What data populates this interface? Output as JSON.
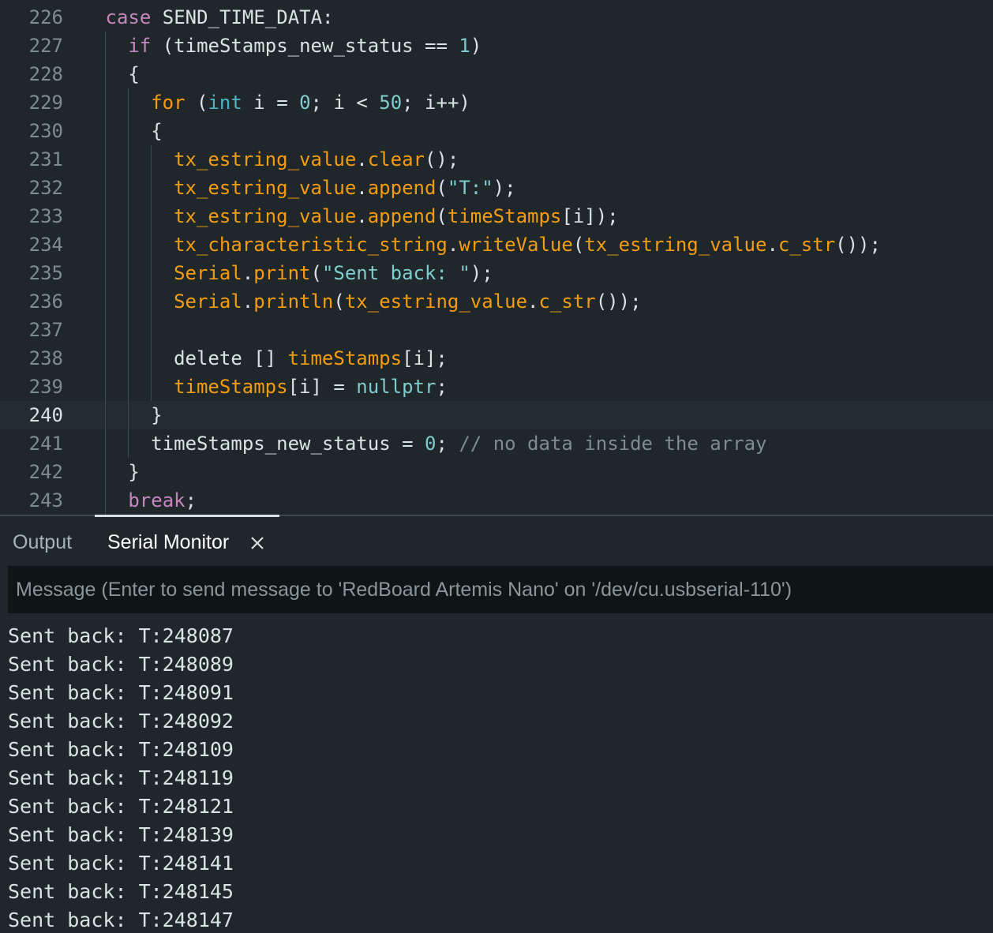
{
  "editor": {
    "lines": [
      {
        "num": "226",
        "indent": 8,
        "tokens": [
          [
            "kw",
            "case"
          ],
          [
            "id",
            " SEND_TIME_DATA:"
          ]
        ]
      },
      {
        "num": "227",
        "indent": 9,
        "tokens": [
          [
            "kw",
            "if"
          ],
          [
            "id",
            " (timeStamps_new_status == "
          ],
          [
            "num",
            "1"
          ],
          [
            "id",
            ")"
          ]
        ]
      },
      {
        "num": "228",
        "indent": 9,
        "tokens": [
          [
            "id",
            "{"
          ]
        ]
      },
      {
        "num": "229",
        "indent": 10,
        "tokens": [
          [
            "kw2",
            "for"
          ],
          [
            "id",
            " ("
          ],
          [
            "type",
            "int"
          ],
          [
            "id",
            " i = "
          ],
          [
            "num",
            "0"
          ],
          [
            "id",
            "; i < "
          ],
          [
            "num",
            "50"
          ],
          [
            "id",
            "; i++)"
          ]
        ]
      },
      {
        "num": "230",
        "indent": 10,
        "tokens": [
          [
            "id",
            "{"
          ]
        ]
      },
      {
        "num": "231",
        "indent": 11,
        "tokens": [
          [
            "fn",
            "tx_estring_value"
          ],
          [
            "id",
            "."
          ],
          [
            "fn",
            "clear"
          ],
          [
            "id",
            "();"
          ]
        ]
      },
      {
        "num": "232",
        "indent": 11,
        "tokens": [
          [
            "fn",
            "tx_estring_value"
          ],
          [
            "id",
            "."
          ],
          [
            "fn",
            "append"
          ],
          [
            "id",
            "("
          ],
          [
            "str",
            "\"T:\""
          ],
          [
            "id",
            ");"
          ]
        ]
      },
      {
        "num": "233",
        "indent": 11,
        "tokens": [
          [
            "fn",
            "tx_estring_value"
          ],
          [
            "id",
            "."
          ],
          [
            "fn",
            "append"
          ],
          [
            "id",
            "("
          ],
          [
            "fn",
            "timeStamps"
          ],
          [
            "id",
            "[i]);"
          ]
        ]
      },
      {
        "num": "234",
        "indent": 11,
        "tokens": [
          [
            "fn",
            "tx_characteristic_string"
          ],
          [
            "id",
            "."
          ],
          [
            "fn",
            "writeValue"
          ],
          [
            "id",
            "("
          ],
          [
            "fn",
            "tx_estring_value"
          ],
          [
            "id",
            "."
          ],
          [
            "fn",
            "c_str"
          ],
          [
            "id",
            "());"
          ]
        ]
      },
      {
        "num": "235",
        "indent": 11,
        "tokens": [
          [
            "fn",
            "Serial"
          ],
          [
            "id",
            "."
          ],
          [
            "fn",
            "print"
          ],
          [
            "id",
            "("
          ],
          [
            "str",
            "\"Sent back: \""
          ],
          [
            "id",
            ");"
          ]
        ]
      },
      {
        "num": "236",
        "indent": 11,
        "tokens": [
          [
            "fn",
            "Serial"
          ],
          [
            "id",
            "."
          ],
          [
            "fn",
            "println"
          ],
          [
            "id",
            "("
          ],
          [
            "fn",
            "tx_estring_value"
          ],
          [
            "id",
            "."
          ],
          [
            "fn",
            "c_str"
          ],
          [
            "id",
            "());"
          ]
        ]
      },
      {
        "num": "237",
        "indent": 11,
        "tokens": []
      },
      {
        "num": "238",
        "indent": 11,
        "tokens": [
          [
            "id",
            "delete [] "
          ],
          [
            "fn",
            "timeStamps"
          ],
          [
            "id",
            "[i];"
          ]
        ]
      },
      {
        "num": "239",
        "indent": 11,
        "tokens": [
          [
            "fn",
            "timeStamps"
          ],
          [
            "id",
            "[i] = "
          ],
          [
            "lit",
            "nullptr"
          ],
          [
            "id",
            ";"
          ]
        ]
      },
      {
        "num": "240",
        "indent": 10,
        "active": true,
        "tokens": [
          [
            "id",
            "}"
          ]
        ]
      },
      {
        "num": "241",
        "indent": 10,
        "tokens": [
          [
            "id",
            "timeStamps_new_status = "
          ],
          [
            "num",
            "0"
          ],
          [
            "id",
            "; "
          ],
          [
            "cm",
            "// no data inside the array"
          ]
        ]
      },
      {
        "num": "242",
        "indent": 9,
        "tokens": [
          [
            "id",
            "}"
          ]
        ]
      },
      {
        "num": "243",
        "indent": 9,
        "tokens": [
          [
            "kw",
            "break"
          ],
          [
            "id",
            ";"
          ]
        ]
      }
    ]
  },
  "panel": {
    "tabs": {
      "output": "Output",
      "serial_monitor": "Serial Monitor"
    },
    "message_placeholder": "Message (Enter to send message to 'RedBoard Artemis Nano' on '/dev/cu.usbserial-110')",
    "serial_lines": [
      "Sent back: T:248087",
      "Sent back: T:248089",
      "Sent back: T:248091",
      "Sent back: T:248092",
      "Sent back: T:248109",
      "Sent back: T:248119",
      "Sent back: T:248121",
      "Sent back: T:248139",
      "Sent back: T:248141",
      "Sent back: T:248145",
      "Sent back: T:248147"
    ]
  },
  "colors": {
    "background": "#1f272a",
    "keyword": "#c586c0",
    "function": "#f39c12",
    "number": "#7fcbcd",
    "comment": "#7f8c8d",
    "text": "#dae3e3"
  }
}
